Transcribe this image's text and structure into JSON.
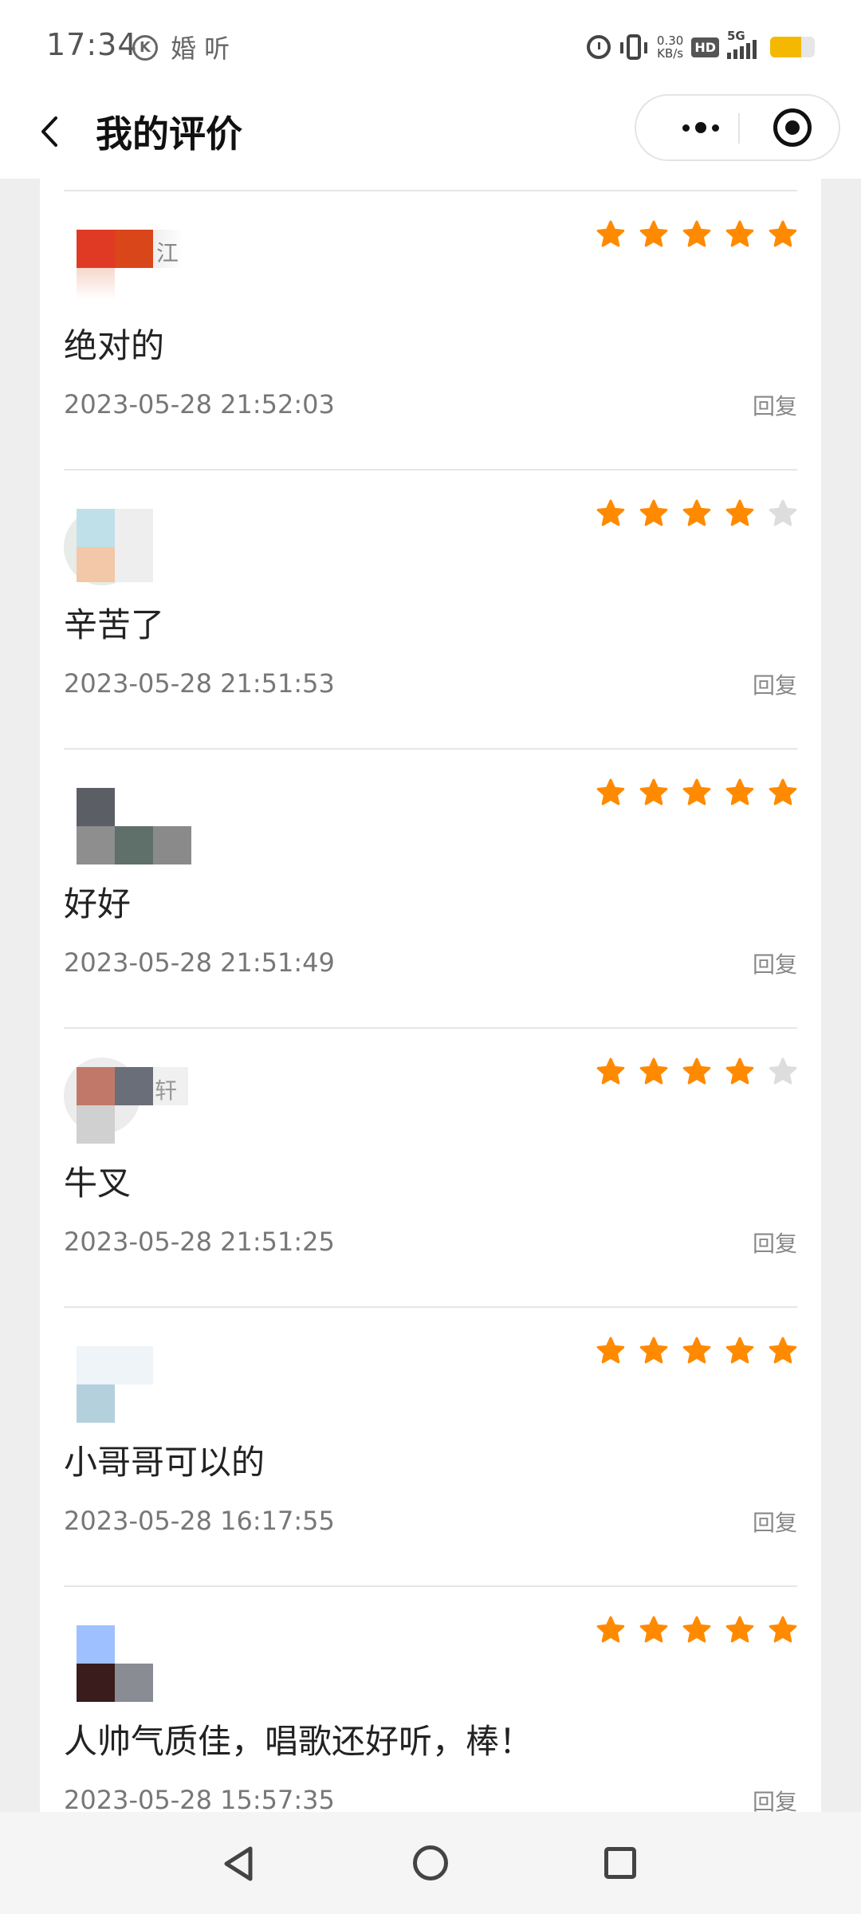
{
  "status_bar": {
    "time": "17:34",
    "carrier_icon": "K",
    "app_text": "婚 听",
    "net_speed_value": "0.30",
    "net_speed_unit": "KB/s",
    "hd_label": "HD",
    "network_label": "5G",
    "battery_level": 0.7
  },
  "header": {
    "title": "我的评价",
    "back_icon": "chevron-left-icon",
    "more_icon": "more-dots-icon",
    "close_icon": "target-icon"
  },
  "reviews": [
    {
      "comment": "绝对的",
      "date": "2023-05-28 21:52:03",
      "rating": 5,
      "reply_label": "回复",
      "name_fragment": "江"
    },
    {
      "comment": "辛苦了",
      "date": "2023-05-28 21:51:53",
      "rating": 4,
      "reply_label": "回复",
      "name_fragment": ""
    },
    {
      "comment": "好好",
      "date": "2023-05-28 21:51:49",
      "rating": 5,
      "reply_label": "回复",
      "name_fragment": ""
    },
    {
      "comment": "牛叉",
      "date": "2023-05-28 21:51:25",
      "rating": 4,
      "reply_label": "回复",
      "name_fragment": "轩"
    },
    {
      "comment": "小哥哥可以的",
      "date": "2023-05-28 16:17:55",
      "rating": 5,
      "reply_label": "回复",
      "name_fragment": ""
    },
    {
      "comment": "人帅气质佳，唱歌还好听，棒！",
      "date": "2023-05-28 15:57:35",
      "rating": 5,
      "reply_label": "回复",
      "name_fragment": ""
    }
  ],
  "colors": {
    "star_active": "#ff8a00",
    "star_inactive": "#dddddd"
  },
  "bottom_nav": {
    "back_icon": "triangle-back-icon",
    "home_icon": "circle-home-icon",
    "recent_icon": "square-recent-icon"
  }
}
